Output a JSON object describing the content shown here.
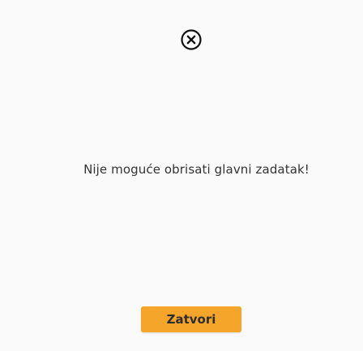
{
  "dialog": {
    "icon": "close-circle-icon",
    "message": "Nije moguće obrisati glavni zadatak!",
    "close_label": "Zatvori"
  },
  "colors": {
    "background": "#fafafa",
    "accent": "#f5a52a",
    "icon": "#111111",
    "text": "#333333"
  }
}
